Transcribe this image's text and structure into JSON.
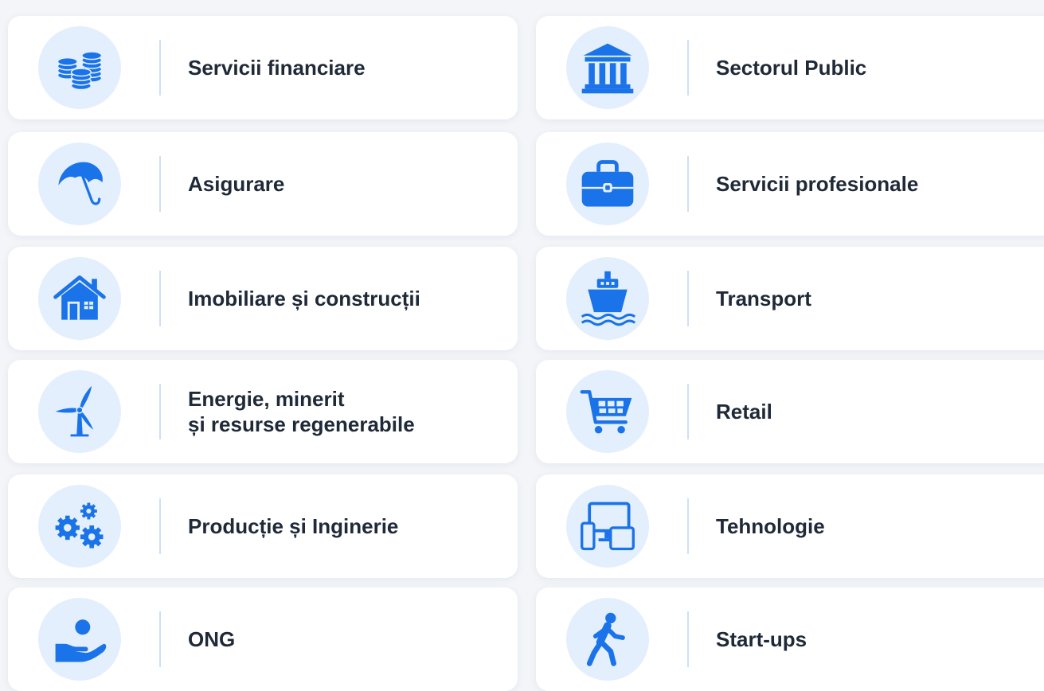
{
  "colors": {
    "accent": "#1a73e8",
    "icon_background": "#e3effd",
    "card_background": "#ffffff",
    "page_background": "#f3f5f8",
    "text": "#1f2937",
    "divider": "#cfe0f5"
  },
  "sectors": {
    "left": [
      {
        "label": "Servicii financiare",
        "icon": "coins-icon"
      },
      {
        "label": "Asigurare",
        "icon": "umbrella-icon"
      },
      {
        "label": "Imobiliare și construcții",
        "icon": "house-icon"
      },
      {
        "label": "Energie, minerit\nși resurse regenerabile",
        "icon": "wind-turbine-icon"
      },
      {
        "label": "Producție și Inginerie",
        "icon": "gears-icon"
      },
      {
        "label": "ONG",
        "icon": "hand-person-icon"
      }
    ],
    "right": [
      {
        "label": "Sectorul Public",
        "icon": "government-building-icon"
      },
      {
        "label": "Servicii profesionale",
        "icon": "briefcase-icon"
      },
      {
        "label": "Transport",
        "icon": "ship-icon"
      },
      {
        "label": "Retail",
        "icon": "shopping-cart-icon"
      },
      {
        "label": "Tehnologie",
        "icon": "devices-icon"
      },
      {
        "label": "Start-ups",
        "icon": "walking-person-icon"
      }
    ]
  }
}
